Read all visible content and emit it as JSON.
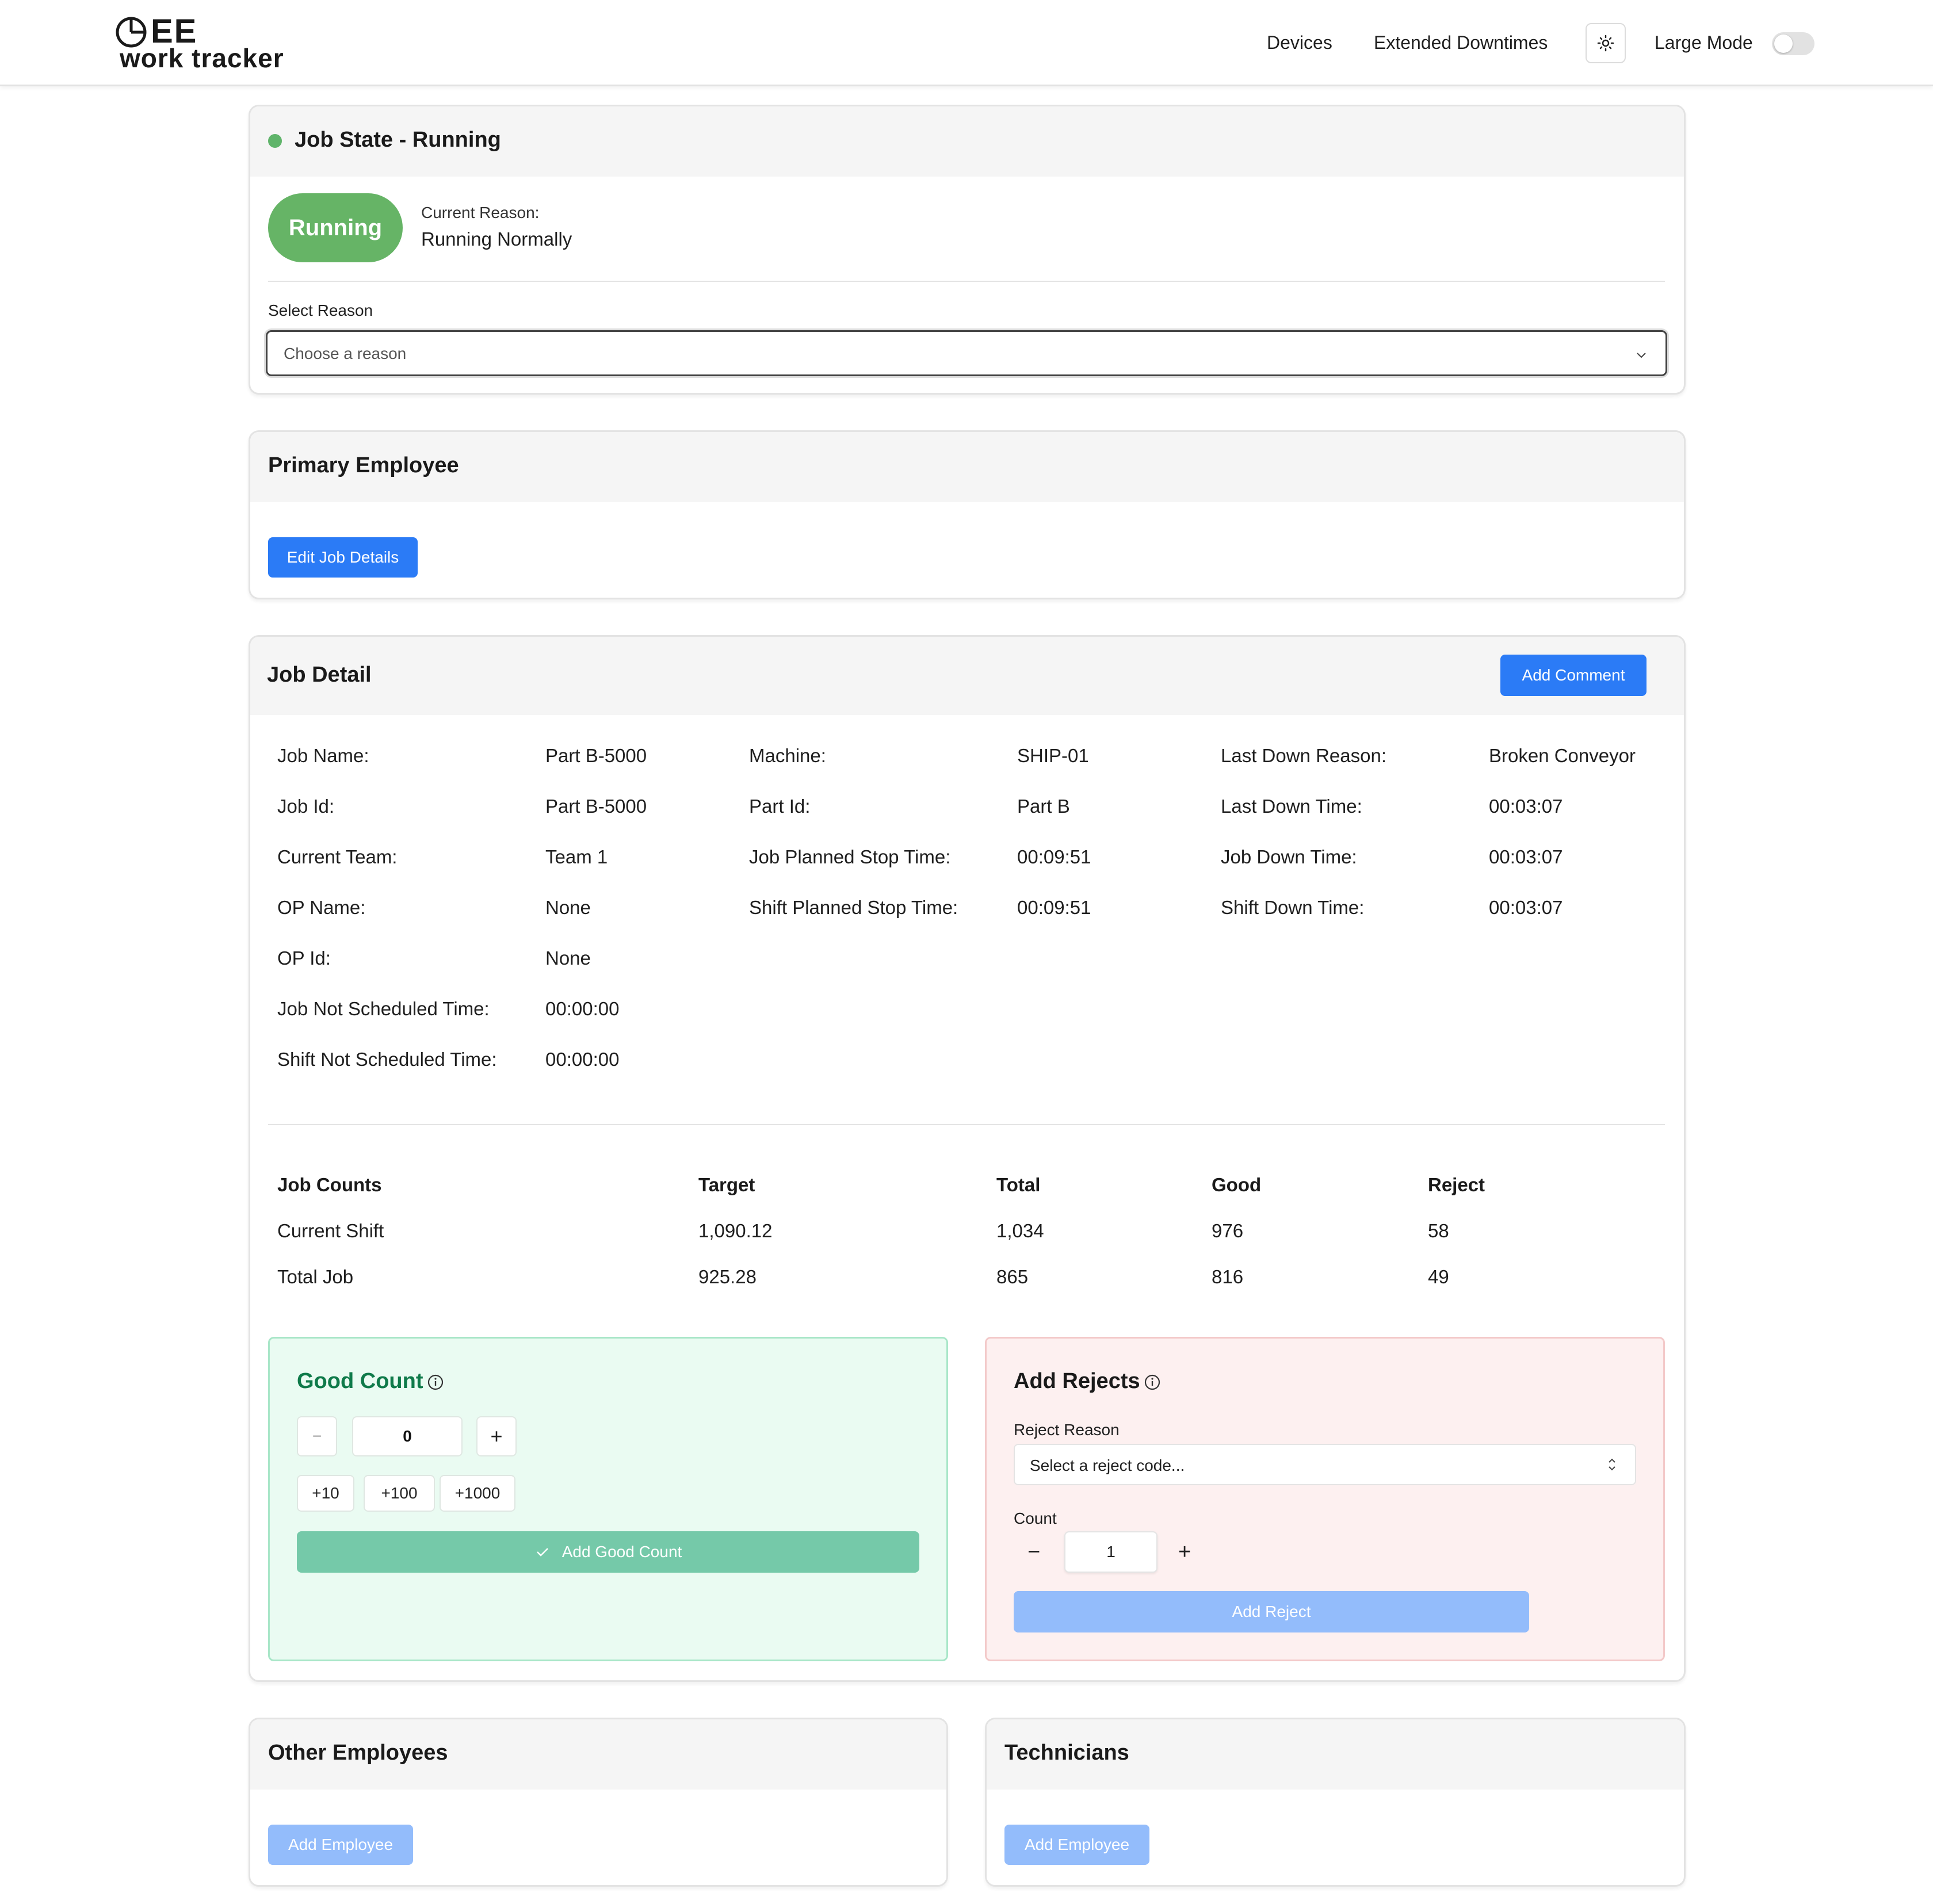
{
  "header": {
    "logo_top": "EE",
    "logo_bottom": "work tracker",
    "nav": {
      "devices": "Devices",
      "extended_downtimes": "Extended Downtimes"
    },
    "large_mode_label": "Large Mode",
    "large_mode_on": false
  },
  "job_state": {
    "title": "Job State - Running",
    "status_pill": "Running",
    "current_reason_label": "Current Reason:",
    "current_reason_value": "Running Normally",
    "select_reason_label": "Select Reason",
    "select_placeholder": "Choose a reason",
    "status_color": "#66b466"
  },
  "primary_employee": {
    "title": "Primary Employee",
    "edit_button": "Edit Job Details"
  },
  "job_detail": {
    "title": "Job Detail",
    "add_comment_button": "Add Comment",
    "col1": [
      {
        "label": "Job Name:",
        "value": "Part B-5000"
      },
      {
        "label": "Job Id:",
        "value": "Part B-5000"
      },
      {
        "label": "Current Team:",
        "value": "Team 1"
      },
      {
        "label": "OP Name:",
        "value": "None"
      },
      {
        "label": "OP Id:",
        "value": "None"
      },
      {
        "label": "Job Not Scheduled Time:",
        "value": "00:00:00"
      },
      {
        "label": "Shift Not Scheduled Time:",
        "value": "00:00:00"
      }
    ],
    "col2": [
      {
        "label": "Machine:",
        "value": "SHIP-01"
      },
      {
        "label": "Part Id:",
        "value": "Part B"
      },
      {
        "label": "Job Planned Stop Time:",
        "value": "00:09:51"
      },
      {
        "label": "Shift Planned Stop Time:",
        "value": "00:09:51"
      }
    ],
    "col3": [
      {
        "label": "Last Down Reason:",
        "value": "Broken Conveyor"
      },
      {
        "label": "Last Down Time:",
        "value": "00:03:07"
      },
      {
        "label": "Job Down Time:",
        "value": "00:03:07"
      },
      {
        "label": "Shift Down Time:",
        "value": "00:03:07"
      }
    ],
    "counts_table": {
      "headers": [
        "Job Counts",
        "Target",
        "Total",
        "Good",
        "Reject"
      ],
      "rows": [
        [
          "Current Shift",
          "1,090.12",
          "1,034",
          "976",
          "58"
        ],
        [
          "Total Job",
          "925.28",
          "865",
          "816",
          "49"
        ]
      ]
    }
  },
  "good_count": {
    "title": "Good Count",
    "minus": "−",
    "plus": "+",
    "value": "0",
    "increments": [
      "+10",
      "+100",
      "+1000"
    ],
    "add_button": "Add Good Count",
    "accent": "#0f7a4a"
  },
  "add_rejects": {
    "title": "Add Rejects",
    "reason_label": "Reject Reason",
    "reason_placeholder": "Select a reject code...",
    "count_label": "Count",
    "minus": "−",
    "plus": "+",
    "count_value": "1",
    "add_button": "Add Reject"
  },
  "other_employees": {
    "title": "Other Employees",
    "add_button": "Add Employee"
  },
  "technicians": {
    "title": "Technicians",
    "add_button": "Add Employee"
  }
}
